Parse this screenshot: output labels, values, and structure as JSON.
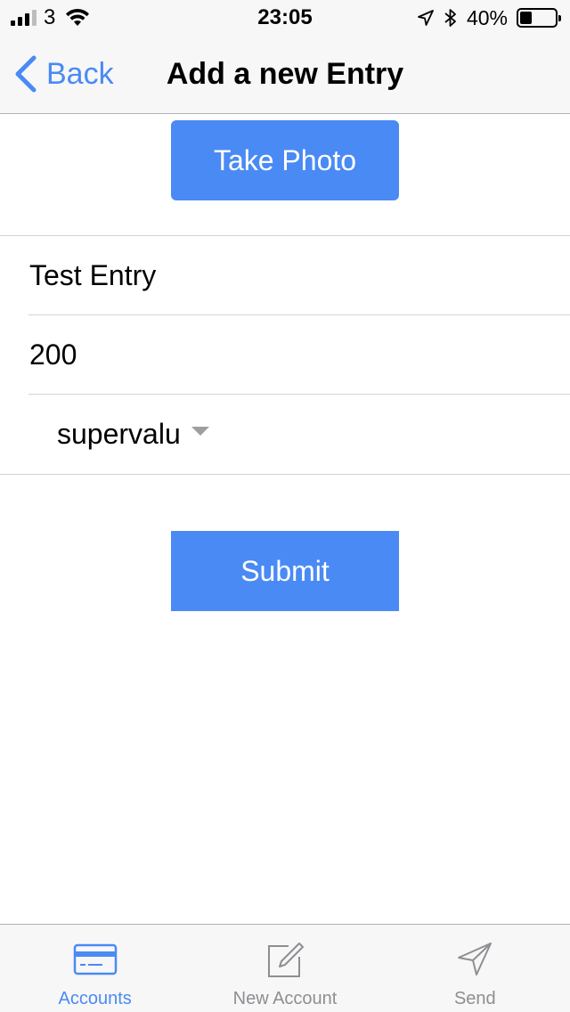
{
  "status_bar": {
    "carrier": "3",
    "time": "23:05",
    "battery_percent": "40%",
    "battery_level": 0.4,
    "signal_bars": 3,
    "icons": [
      "signal-icon",
      "wifi-icon",
      "location-icon",
      "bluetooth-icon",
      "battery-icon"
    ]
  },
  "nav": {
    "back_label": "Back",
    "title": "Add a new Entry"
  },
  "actions": {
    "take_photo_label": "Take Photo",
    "submit_label": "Submit"
  },
  "form": {
    "name_value": "Test Entry",
    "amount_value": "200",
    "store_value": "supervalu"
  },
  "tabs": [
    {
      "label": "Accounts",
      "icon": "credit-card-icon",
      "active": true
    },
    {
      "label": "New Account",
      "icon": "compose-icon",
      "active": false
    },
    {
      "label": "Send",
      "icon": "send-icon",
      "active": false
    }
  ],
  "colors": {
    "accent": "#4a8af4",
    "bar_background": "#f7f7f7",
    "inactive_tab": "#8e8e93"
  }
}
